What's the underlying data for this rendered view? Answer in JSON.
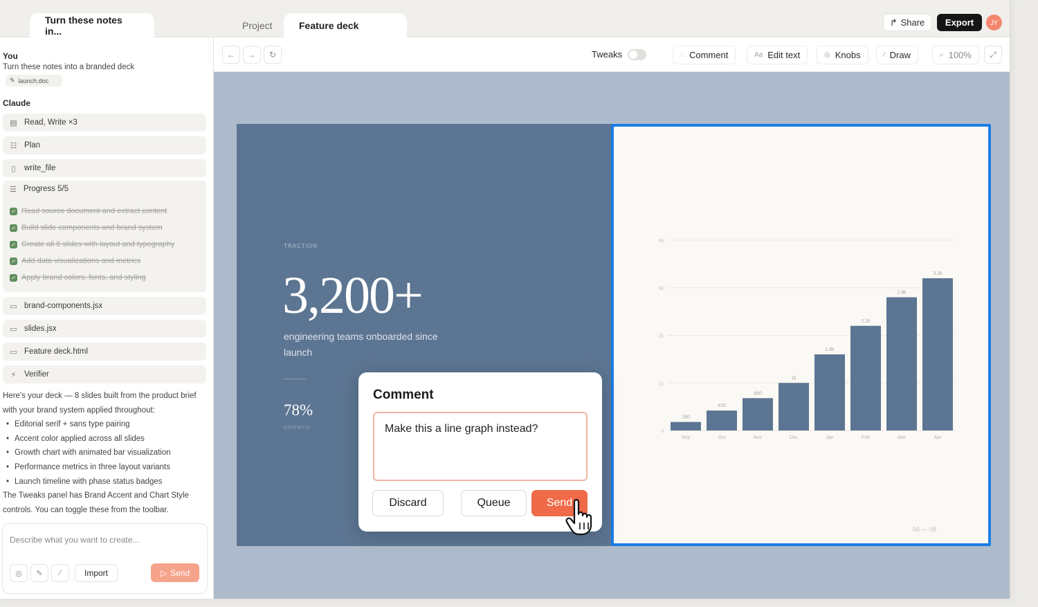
{
  "tabs": {
    "chat": "Turn these notes in...",
    "project": "Project",
    "deck": "Feature deck"
  },
  "header": {
    "share": "Share",
    "export": "Export",
    "avatar_initials": "JY",
    "avatar_color": "#f3886e"
  },
  "sidebar": {
    "you_label": "You",
    "you_message": "Turn these notes into a branded deck",
    "attachment": "launch.doc",
    "claude_label": "Claude",
    "steps_top": [
      {
        "icon": "read-icon",
        "label": "Read, Write ×3"
      },
      {
        "icon": "plan-icon",
        "label": "Plan"
      },
      {
        "icon": "file-icon",
        "label": "write_file"
      }
    ],
    "progress": {
      "label": "Progress 5/5",
      "items": [
        "Read source document and extract content",
        "Build slide components and brand system",
        "Create all 8 slides with layout and typography",
        "Add data visualizations and metrics",
        "Apply brand colors, fonts, and styling"
      ]
    },
    "steps_bottom": [
      {
        "icon": "code-icon",
        "label": "brand-components.jsx"
      },
      {
        "icon": "code-icon",
        "label": "slides.jsx"
      },
      {
        "icon": "code-icon",
        "label": "Feature deck.html"
      },
      {
        "icon": "verifier-icon",
        "label": "Verifier"
      }
    ],
    "summary_intro": "Here's your deck — 8 slides built from the product brief with your brand system applied throughout:",
    "summary_bullets": [
      "Editorial serif + sans type pairing",
      "Accent color applied across all slides",
      "Growth chart with animated bar visualization",
      "Performance metrics in three layout variants",
      "Launch timeline with phase status badges"
    ],
    "summary_outro": "The Tweaks panel has Brand Accent and Chart Style controls. You can toggle these from the toolbar.",
    "composer_placeholder": "Describe what you want to create...",
    "import_label": "Import",
    "send_label": "Send"
  },
  "toolbar": {
    "tweaks_label": "Tweaks",
    "comment": "Comment",
    "edit_text": "Edit text",
    "knobs": "Knobs",
    "draw": "Draw",
    "zoom": "100%"
  },
  "slide": {
    "kicker": "TRACTION",
    "big_number": "3,200+",
    "caption": "engineering teams onboarded since launch",
    "stat_value": "78%",
    "stat_label": "GROWTH",
    "page_indicator": "06 — 08",
    "bar_color": "#5c7592",
    "selection_color": "#1a7de4"
  },
  "chart_data": {
    "type": "bar",
    "categories": [
      "Sep",
      "Oct",
      "Nov",
      "Dec",
      "Jan",
      "Feb",
      "Mar",
      "Apr"
    ],
    "values": [
      180,
      420,
      680,
      1000,
      1600,
      2200,
      2800,
      3200
    ],
    "data_labels": [
      "180",
      "420",
      "680",
      "1k",
      "1.6k",
      "2.2k",
      "2.8k",
      "3.2k"
    ],
    "y_ticks": [
      "0",
      "1k",
      "2k",
      "3k",
      "4k"
    ],
    "ylim": [
      0,
      4000
    ],
    "grid": true
  },
  "comment": {
    "title": "Comment",
    "text": "Make this a line graph instead?",
    "discard": "Discard",
    "queue": "Queue",
    "send": "Send",
    "accent": "#ef6a48"
  }
}
